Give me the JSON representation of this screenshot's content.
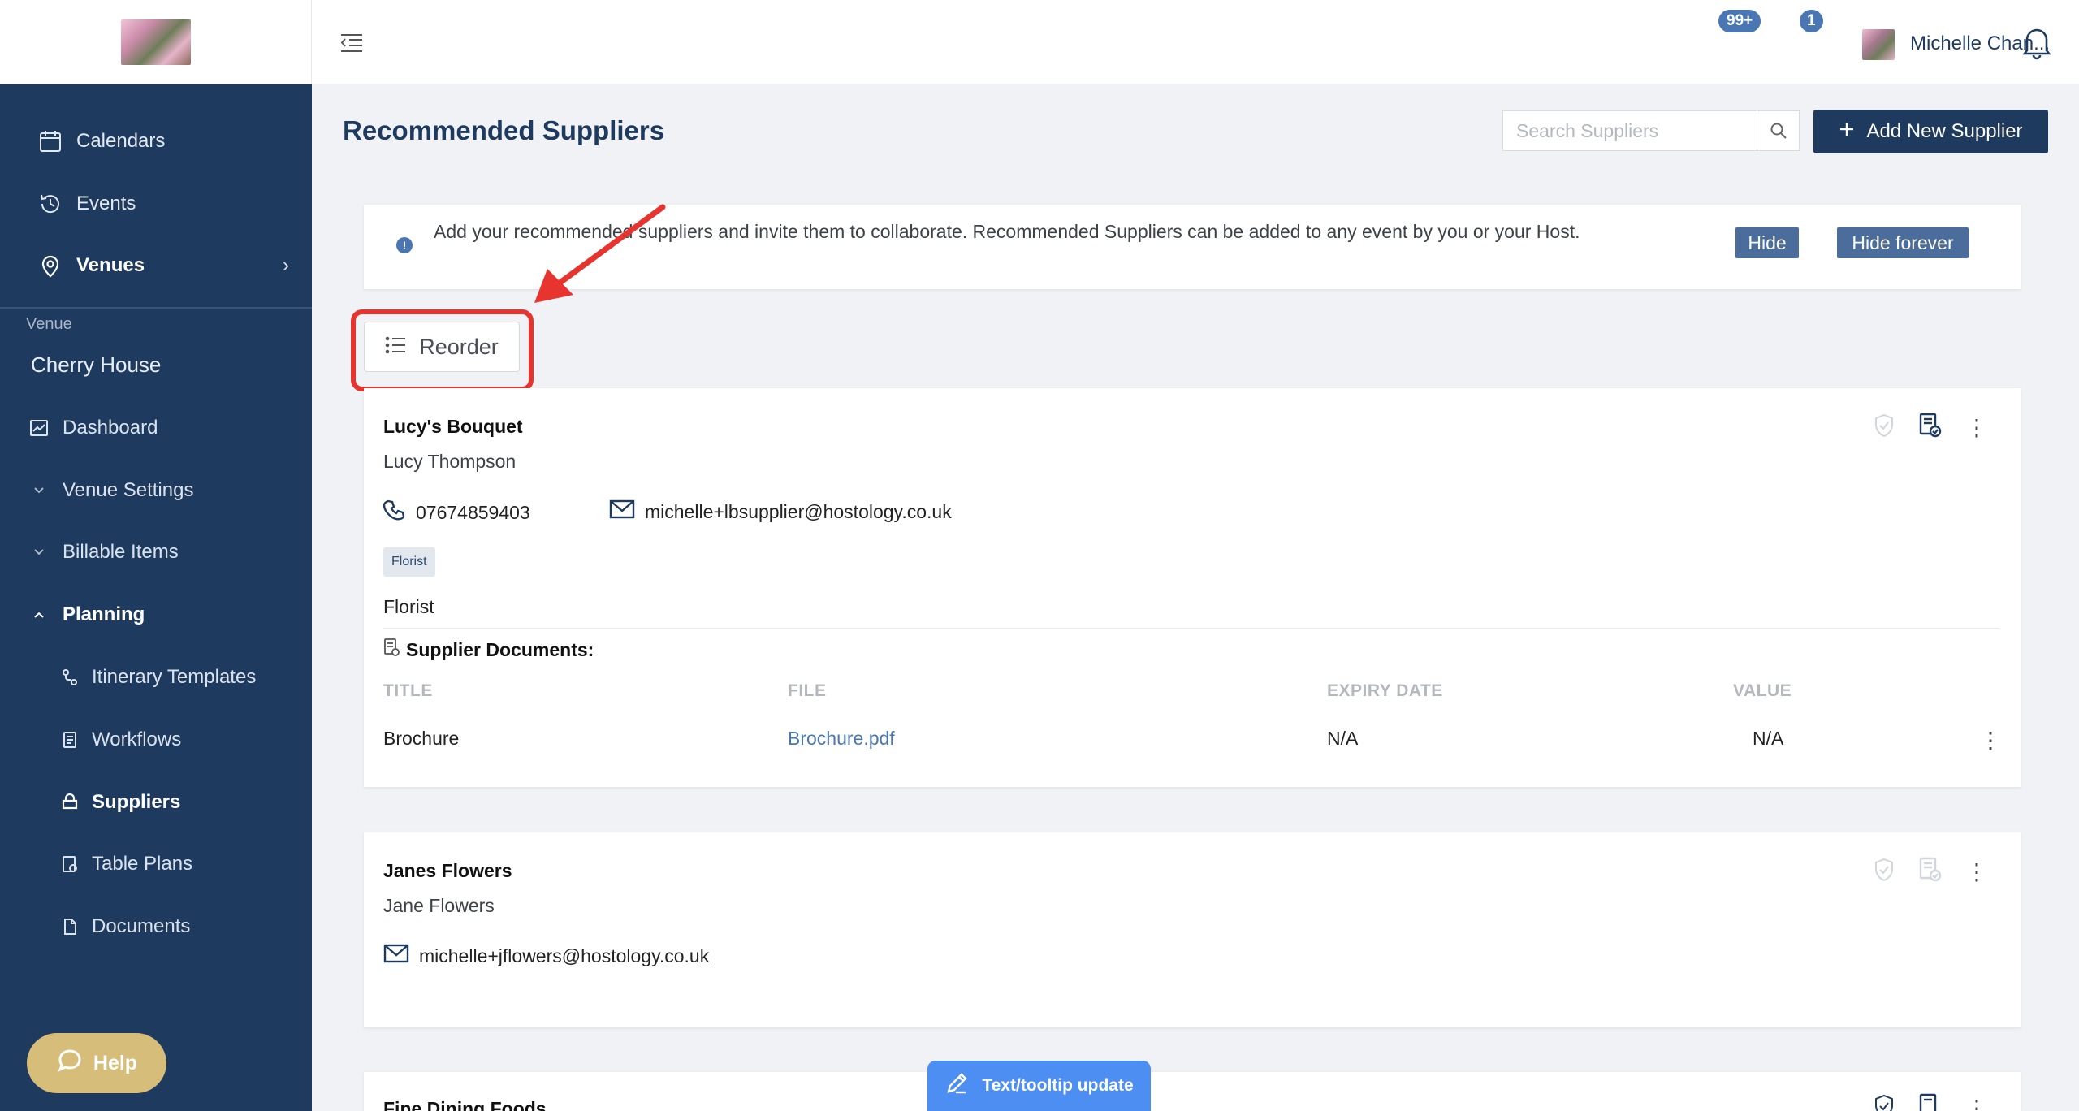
{
  "app": {
    "logo_alt": "cherry blossom logo"
  },
  "sidebar": {
    "main_items": [
      {
        "label": "Calendars",
        "icon": "calendar-icon"
      },
      {
        "label": "Events",
        "icon": "clock-history-icon"
      },
      {
        "label": "Venues",
        "icon": "map-pin-icon",
        "active": true
      }
    ],
    "venue_caption": "Venue",
    "venue_name": "Cherry House",
    "venue_items": [
      {
        "label": "Dashboard",
        "icon": "chart-icon"
      },
      {
        "label": "Venue Settings",
        "icon": "chevron-down-icon"
      },
      {
        "label": "Billable Items",
        "icon": "chevron-down-icon"
      },
      {
        "label": "Planning",
        "icon": "chevron-up-icon"
      }
    ],
    "planning_items": [
      {
        "label": "Itinerary Templates",
        "icon": "route-icon"
      },
      {
        "label": "Workflows",
        "icon": "workflow-icon"
      },
      {
        "label": "Suppliers",
        "icon": "store-icon",
        "active": true
      },
      {
        "label": "Table Plans",
        "icon": "table-plan-icon"
      },
      {
        "label": "Documents",
        "icon": "document-icon"
      }
    ],
    "help_label": "Help"
  },
  "topbar": {
    "notifications_badge": "99+",
    "messages_badge": "1",
    "user_name": "Michelle Chan..."
  },
  "page": {
    "title": "Recommended Suppliers",
    "search_placeholder": "Search Suppliers",
    "add_button": "Add New Supplier"
  },
  "banner": {
    "text": "Add your recommended suppliers and invite them to collaborate. Recommended Suppliers can be added to any event by you or your Host.",
    "hide_label": "Hide",
    "hide_forever_label": "Hide forever"
  },
  "reorder_label": "Reorder",
  "suppliers": [
    {
      "name": "Lucy's Bouquet",
      "contact": "Lucy Thompson",
      "phone": "07674859403",
      "email": "michelle+lbsupplier@hostology.co.uk",
      "tag": "Florist",
      "category": "Florist",
      "documents_title": "Supplier Documents:",
      "doc_headers": [
        "TITLE",
        "FILE",
        "EXPIRY DATE",
        "VALUE"
      ],
      "documents": [
        {
          "title": "Brochure",
          "file": "Brochure.pdf",
          "expiry": "N/A",
          "value": "N/A"
        }
      ]
    },
    {
      "name": "Janes Flowers",
      "contact": "Jane Flowers",
      "email": "michelle+jflowers@hostology.co.uk"
    },
    {
      "name": "Fine Dining Foods"
    }
  ],
  "tooltip_update_label": "Text/tooltip update",
  "colors": {
    "sidebar_bg": "#1e3a5f",
    "accent": "#4a77b4",
    "help": "#d7bd7a",
    "highlight": "#e8342e"
  }
}
